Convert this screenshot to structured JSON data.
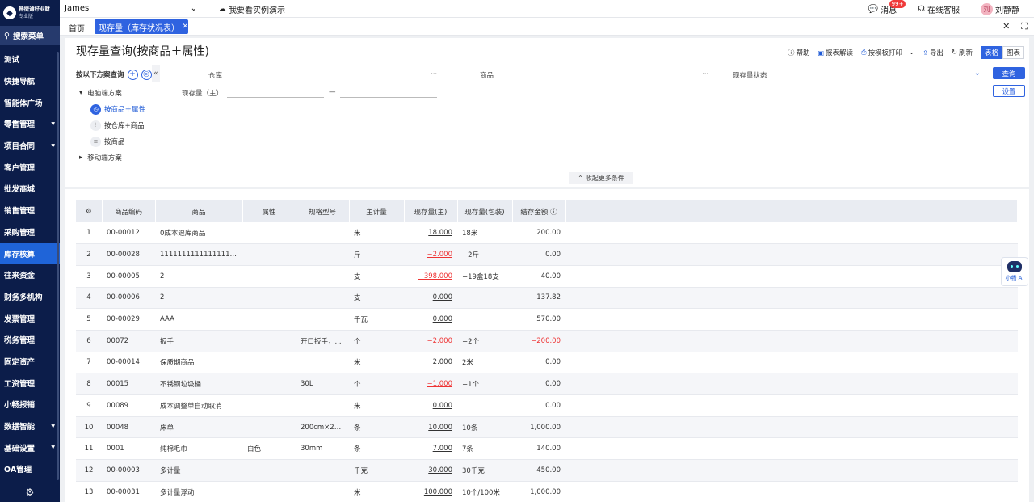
{
  "sidebar": {
    "logo_name": "畅捷通好业财",
    "logo_sub": "专业版",
    "search_label": "搜索菜单",
    "items": [
      {
        "label": "测试",
        "caret": false
      },
      {
        "label": "快捷导航",
        "caret": false
      },
      {
        "label": "智能体广场",
        "caret": false
      },
      {
        "label": "零售管理",
        "caret": true
      },
      {
        "label": "项目合同",
        "caret": true
      },
      {
        "label": "客户管理",
        "caret": false
      },
      {
        "label": "批发商城",
        "caret": false
      },
      {
        "label": "销售管理",
        "caret": false
      },
      {
        "label": "采购管理",
        "caret": false
      },
      {
        "label": "库存核算",
        "caret": false,
        "active": true
      },
      {
        "label": "往来资金",
        "caret": false
      },
      {
        "label": "财务多机构",
        "caret": false
      },
      {
        "label": "发票管理",
        "caret": false
      },
      {
        "label": "税务管理",
        "caret": false
      },
      {
        "label": "固定资产",
        "caret": false
      },
      {
        "label": "工资管理",
        "caret": false
      },
      {
        "label": "小畅报销",
        "caret": false
      },
      {
        "label": "数据智能",
        "caret": true
      },
      {
        "label": "基础设置",
        "caret": true
      },
      {
        "label": "OA管理",
        "caret": false
      }
    ]
  },
  "topbar": {
    "account": "James",
    "demo_link": "我要看实例演示",
    "messages": "消息",
    "messages_badge": "99+",
    "support": "在线客服",
    "user": "刘静静",
    "avatar_initial": "刘"
  },
  "tabs": {
    "home": "首页",
    "active": "现存量（库存状况表）"
  },
  "page": {
    "title": "现存量查询(按商品＋属性)",
    "toolbar": {
      "help": "帮助",
      "report_read": "报表解读",
      "template_print": "按模板打印",
      "export": "导出",
      "refresh": "刷新",
      "view_table": "表格",
      "view_chart": "图表"
    }
  },
  "scheme": {
    "heading": "按以下方案查询",
    "groups": [
      {
        "label": "电脑端方案",
        "expanded": true,
        "items": [
          {
            "label": "按商品＋属性",
            "selected": true,
            "icon": "clock-icon"
          },
          {
            "label": "按仓库+商品",
            "selected": false,
            "icon": "chart-icon"
          },
          {
            "label": "按商品",
            "selected": false,
            "icon": "list-icon"
          }
        ]
      },
      {
        "label": "移动端方案",
        "expanded": false,
        "items": []
      }
    ]
  },
  "filters": {
    "warehouse_label": "仓库",
    "product_label": "商品",
    "status_label": "现存量状态",
    "qty_label": "现存量（主）",
    "range_sep": "—",
    "more_dots": "···",
    "query_btn": "查询",
    "settings_btn": "设置",
    "collapse_more": "收起更多条件"
  },
  "table": {
    "columns": [
      "",
      "商品编码",
      "商品",
      "属性",
      "规格型号",
      "主计量",
      "现存量(主)",
      "现存量(包装)",
      "结存金额"
    ],
    "rows": [
      {
        "no": "1",
        "code": "00-00012",
        "name": "0成本退库商品",
        "attr": "",
        "spec": "",
        "unit": "米",
        "qty": "18.000",
        "pack": "18米",
        "amount": "200.00",
        "neg_qty": false,
        "neg_amt": false
      },
      {
        "no": "2",
        "code": "00-00028",
        "name": "1111111111111111111111111111",
        "attr": "",
        "spec": "",
        "unit": "斤",
        "qty": "−2.000",
        "pack": "−2斤",
        "amount": "0.00",
        "neg_qty": true,
        "neg_amt": false
      },
      {
        "no": "3",
        "code": "00-00005",
        "name": "2",
        "attr": "",
        "spec": "",
        "unit": "支",
        "qty": "−398.000",
        "pack": "−19盒18支",
        "amount": "40.00",
        "neg_qty": true,
        "neg_amt": false
      },
      {
        "no": "4",
        "code": "00-00006",
        "name": "2",
        "attr": "",
        "spec": "",
        "unit": "支",
        "qty": "0.000",
        "pack": "",
        "amount": "137.82",
        "neg_qty": false,
        "neg_amt": false
      },
      {
        "no": "5",
        "code": "00-00029",
        "name": "AAA",
        "attr": "",
        "spec": "",
        "unit": "千瓦",
        "qty": "0.000",
        "pack": "",
        "amount": "570.00",
        "neg_qty": false,
        "neg_amt": false
      },
      {
        "no": "6",
        "code": "00072",
        "name": "扳手",
        "attr": "",
        "spec": "开口扳手，...",
        "unit": "个",
        "qty": "−2.000",
        "pack": "−2个",
        "amount": "−200.00",
        "neg_qty": true,
        "neg_amt": true
      },
      {
        "no": "7",
        "code": "00-00014",
        "name": "保质期商品",
        "attr": "",
        "spec": "",
        "unit": "米",
        "qty": "2.000",
        "pack": "2米",
        "amount": "0.00",
        "neg_qty": false,
        "neg_amt": false
      },
      {
        "no": "8",
        "code": "00015",
        "name": "不锈钢垃圾桶",
        "attr": "",
        "spec": "30L",
        "unit": "个",
        "qty": "−1.000",
        "pack": "−1个",
        "amount": "0.00",
        "neg_qty": true,
        "neg_amt": false
      },
      {
        "no": "9",
        "code": "00089",
        "name": "成本调整单自动取消",
        "attr": "",
        "spec": "",
        "unit": "米",
        "qty": "0.000",
        "pack": "",
        "amount": "0.00",
        "neg_qty": false,
        "neg_amt": false
      },
      {
        "no": "10",
        "code": "00048",
        "name": "床单",
        "attr": "",
        "spec": "200cm×23...",
        "unit": "条",
        "qty": "10.000",
        "pack": "10条",
        "amount": "1,000.00",
        "neg_qty": false,
        "neg_amt": false
      },
      {
        "no": "11",
        "code": "0001",
        "name": "纯棉毛巾",
        "attr": "白色",
        "spec": "30mm",
        "unit": "条",
        "qty": "7.000",
        "pack": "7条",
        "amount": "140.00",
        "neg_qty": false,
        "neg_amt": false
      },
      {
        "no": "12",
        "code": "00-00003",
        "name": "多计量",
        "attr": "",
        "spec": "",
        "unit": "千克",
        "qty": "30.000",
        "pack": "30千克",
        "amount": "450.00",
        "neg_qty": false,
        "neg_amt": false
      },
      {
        "no": "13",
        "code": "00-00031",
        "name": "多计量浮动",
        "attr": "",
        "spec": "",
        "unit": "米",
        "qty": "100.000",
        "pack": "10个/100米",
        "amount": "1,000.00",
        "neg_qty": false,
        "neg_amt": false
      }
    ]
  },
  "ai": {
    "label": "小畅 AI"
  },
  "colors": {
    "sidebar_bg": "#0c1d4a",
    "accent": "#2f63e0",
    "negative": "#e33333"
  }
}
